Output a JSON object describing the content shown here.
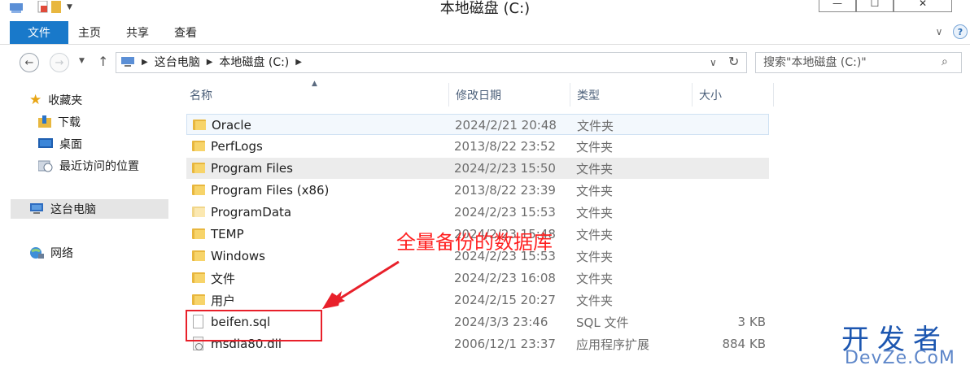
{
  "window": {
    "title": "本地磁盘 (C:)",
    "minimize_glyph": "—",
    "maximize_glyph": "☐",
    "close_glyph": "✕"
  },
  "ribbon": {
    "file_tab": "文件",
    "tabs": [
      "主页",
      "共享",
      "查看"
    ],
    "expand_glyph": "∨",
    "help_glyph": "?"
  },
  "address": {
    "path": [
      "这台电脑",
      "本地磁盘 (C:)"
    ],
    "search_placeholder": "搜索\"本地磁盘 (C:)\""
  },
  "sidebar": {
    "favorites": {
      "label": "收藏夹",
      "items": [
        "下载",
        "桌面",
        "最近访问的位置"
      ]
    },
    "this_pc": "这台电脑",
    "network": "网络"
  },
  "columns": {
    "name": "名称",
    "modified": "修改日期",
    "type": "类型",
    "size": "大小"
  },
  "files": [
    {
      "name": "Oracle",
      "modified": "2024/2/21 20:48",
      "type": "文件夹",
      "size": "",
      "icon": "folder-icon"
    },
    {
      "name": "PerfLogs",
      "modified": "2013/8/22 23:52",
      "type": "文件夹",
      "size": "",
      "icon": "folder-icon"
    },
    {
      "name": "Program Files",
      "modified": "2024/2/23 15:50",
      "type": "文件夹",
      "size": "",
      "icon": "folder-icon"
    },
    {
      "name": "Program Files (x86)",
      "modified": "2013/8/22 23:39",
      "type": "文件夹",
      "size": "",
      "icon": "folder-icon"
    },
    {
      "name": "ProgramData",
      "modified": "2024/2/23 15:53",
      "type": "文件夹",
      "size": "",
      "icon": "folder-icon"
    },
    {
      "name": "TEMP",
      "modified": "2024/2/23 15:48",
      "type": "文件夹",
      "size": "",
      "icon": "folder-icon"
    },
    {
      "name": "Windows",
      "modified": "2024/2/23 15:53",
      "type": "文件夹",
      "size": "",
      "icon": "folder-icon"
    },
    {
      "name": "文件",
      "modified": "2024/2/23 16:08",
      "type": "文件夹",
      "size": "",
      "icon": "folder-icon"
    },
    {
      "name": "用户",
      "modified": "2024/2/15 20:27",
      "type": "文件夹",
      "size": "",
      "icon": "folder-icon"
    },
    {
      "name": "beifen.sql",
      "modified": "2024/3/3 23:46",
      "type": "SQL 文件",
      "size": "3 KB",
      "icon": "document-icon"
    },
    {
      "name": "msdia80.dll",
      "modified": "2006/12/1 23:37",
      "type": "应用程序扩展",
      "size": "884 KB",
      "icon": "dll-icon"
    }
  ],
  "annotation": {
    "text": "全量备份的数据库",
    "color": "#ff2020"
  },
  "watermark": {
    "line1": "开发者",
    "line2": "DevZe.CoM"
  }
}
